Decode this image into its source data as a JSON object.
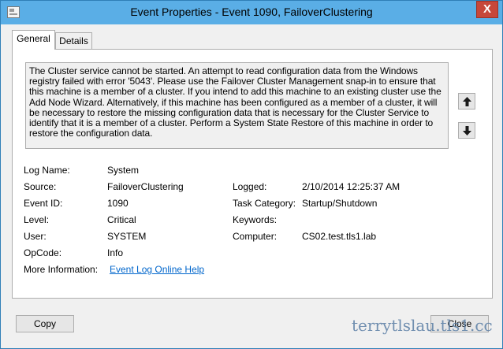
{
  "window": {
    "title": "Event Properties - Event 1090, FailoverClustering"
  },
  "tabs": [
    {
      "label": "General"
    },
    {
      "label": "Details"
    }
  ],
  "description": "The Cluster service cannot be started. An attempt to read configuration data from the Windows registry failed with error '5043'. Please use the Failover Cluster Management snap-in to ensure that this machine is a member of a cluster. If you intend to add this machine to an existing cluster use the Add Node Wizard. Alternatively, if this machine has been configured as a member of a cluster, it will be necessary to restore the missing configuration data that is necessary for the Cluster Service to identify that it is a member of a cluster. Perform a System State Restore of this machine in order to restore the configuration data.",
  "fields": {
    "log_name": {
      "label": "Log Name:",
      "value": "System"
    },
    "source": {
      "label": "Source:",
      "value": "FailoverClustering"
    },
    "logged": {
      "label": "Logged:",
      "value": "2/10/2014 12:25:37 AM"
    },
    "event_id": {
      "label": "Event ID:",
      "value": "1090"
    },
    "task_category": {
      "label": "Task Category:",
      "value": "Startup/Shutdown"
    },
    "level": {
      "label": "Level:",
      "value": "Critical"
    },
    "keywords": {
      "label": "Keywords:",
      "value": ""
    },
    "user": {
      "label": "User:",
      "value": "SYSTEM"
    },
    "computer": {
      "label": "Computer:",
      "value": "CS02.test.tls1.lab"
    },
    "opcode": {
      "label": "OpCode:",
      "value": "Info"
    },
    "more_info": {
      "label": "More Information:",
      "value": "Event Log Online Help"
    }
  },
  "buttons": {
    "copy": "Copy",
    "close": "Close",
    "close_x": "X"
  },
  "watermark": "terrytlslau.tls1.cc",
  "colors": {
    "titlebar": "#5aaee6",
    "close_button": "#c7473a",
    "link": "#0066cc"
  },
  "icons": {
    "window": "event-viewer-icon",
    "up": "arrow-up-icon",
    "down": "arrow-down-icon"
  }
}
